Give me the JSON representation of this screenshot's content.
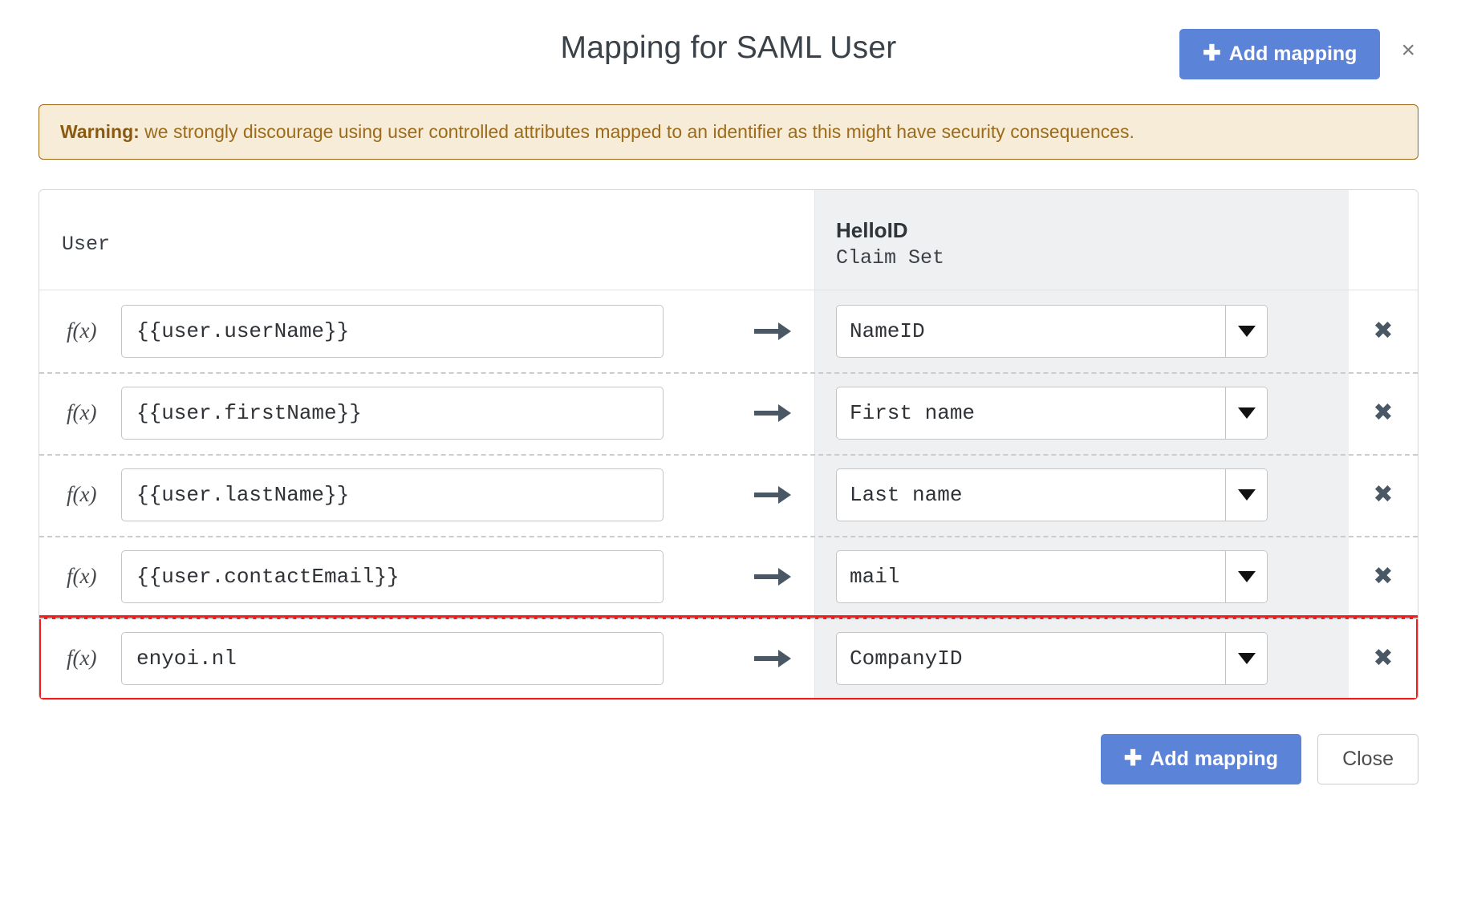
{
  "header": {
    "title": "Mapping for SAML User",
    "add_mapping_label": "Add mapping",
    "plus_icon": "plus-icon",
    "close_icon": "×"
  },
  "warning": {
    "label": "Warning:",
    "text": " we strongly discourage using user controlled attributes mapped to an identifier as this might have security consequences."
  },
  "table": {
    "headers": {
      "left": "User",
      "right_title": "HelloID",
      "right_subtitle": "Claim Set"
    },
    "fx_label": "f(x)",
    "arrow_icon": "arrow-right-icon",
    "delete_icon": "✖",
    "caret_icon": "▼",
    "rows": [
      {
        "source": "{{user.userName}}",
        "target": "NameID",
        "highlighted": false
      },
      {
        "source": "{{user.firstName}}",
        "target": "First name",
        "highlighted": false
      },
      {
        "source": "{{user.lastName}}",
        "target": "Last name",
        "highlighted": false
      },
      {
        "source": "{{user.contactEmail}}",
        "target": "mail",
        "highlighted": false
      },
      {
        "source": "enyoi.nl",
        "target": "CompanyID",
        "highlighted": true
      }
    ]
  },
  "footer": {
    "add_mapping_label": "Add mapping",
    "close_label": "Close"
  },
  "colors": {
    "primary": "#5b83d7",
    "warning_bg": "#f7ecd7",
    "warning_border": "#9c6a17",
    "warning_text": "#9c6b1c",
    "highlight": "#f41b1b",
    "claim_column_bg": "#eff0f2"
  }
}
